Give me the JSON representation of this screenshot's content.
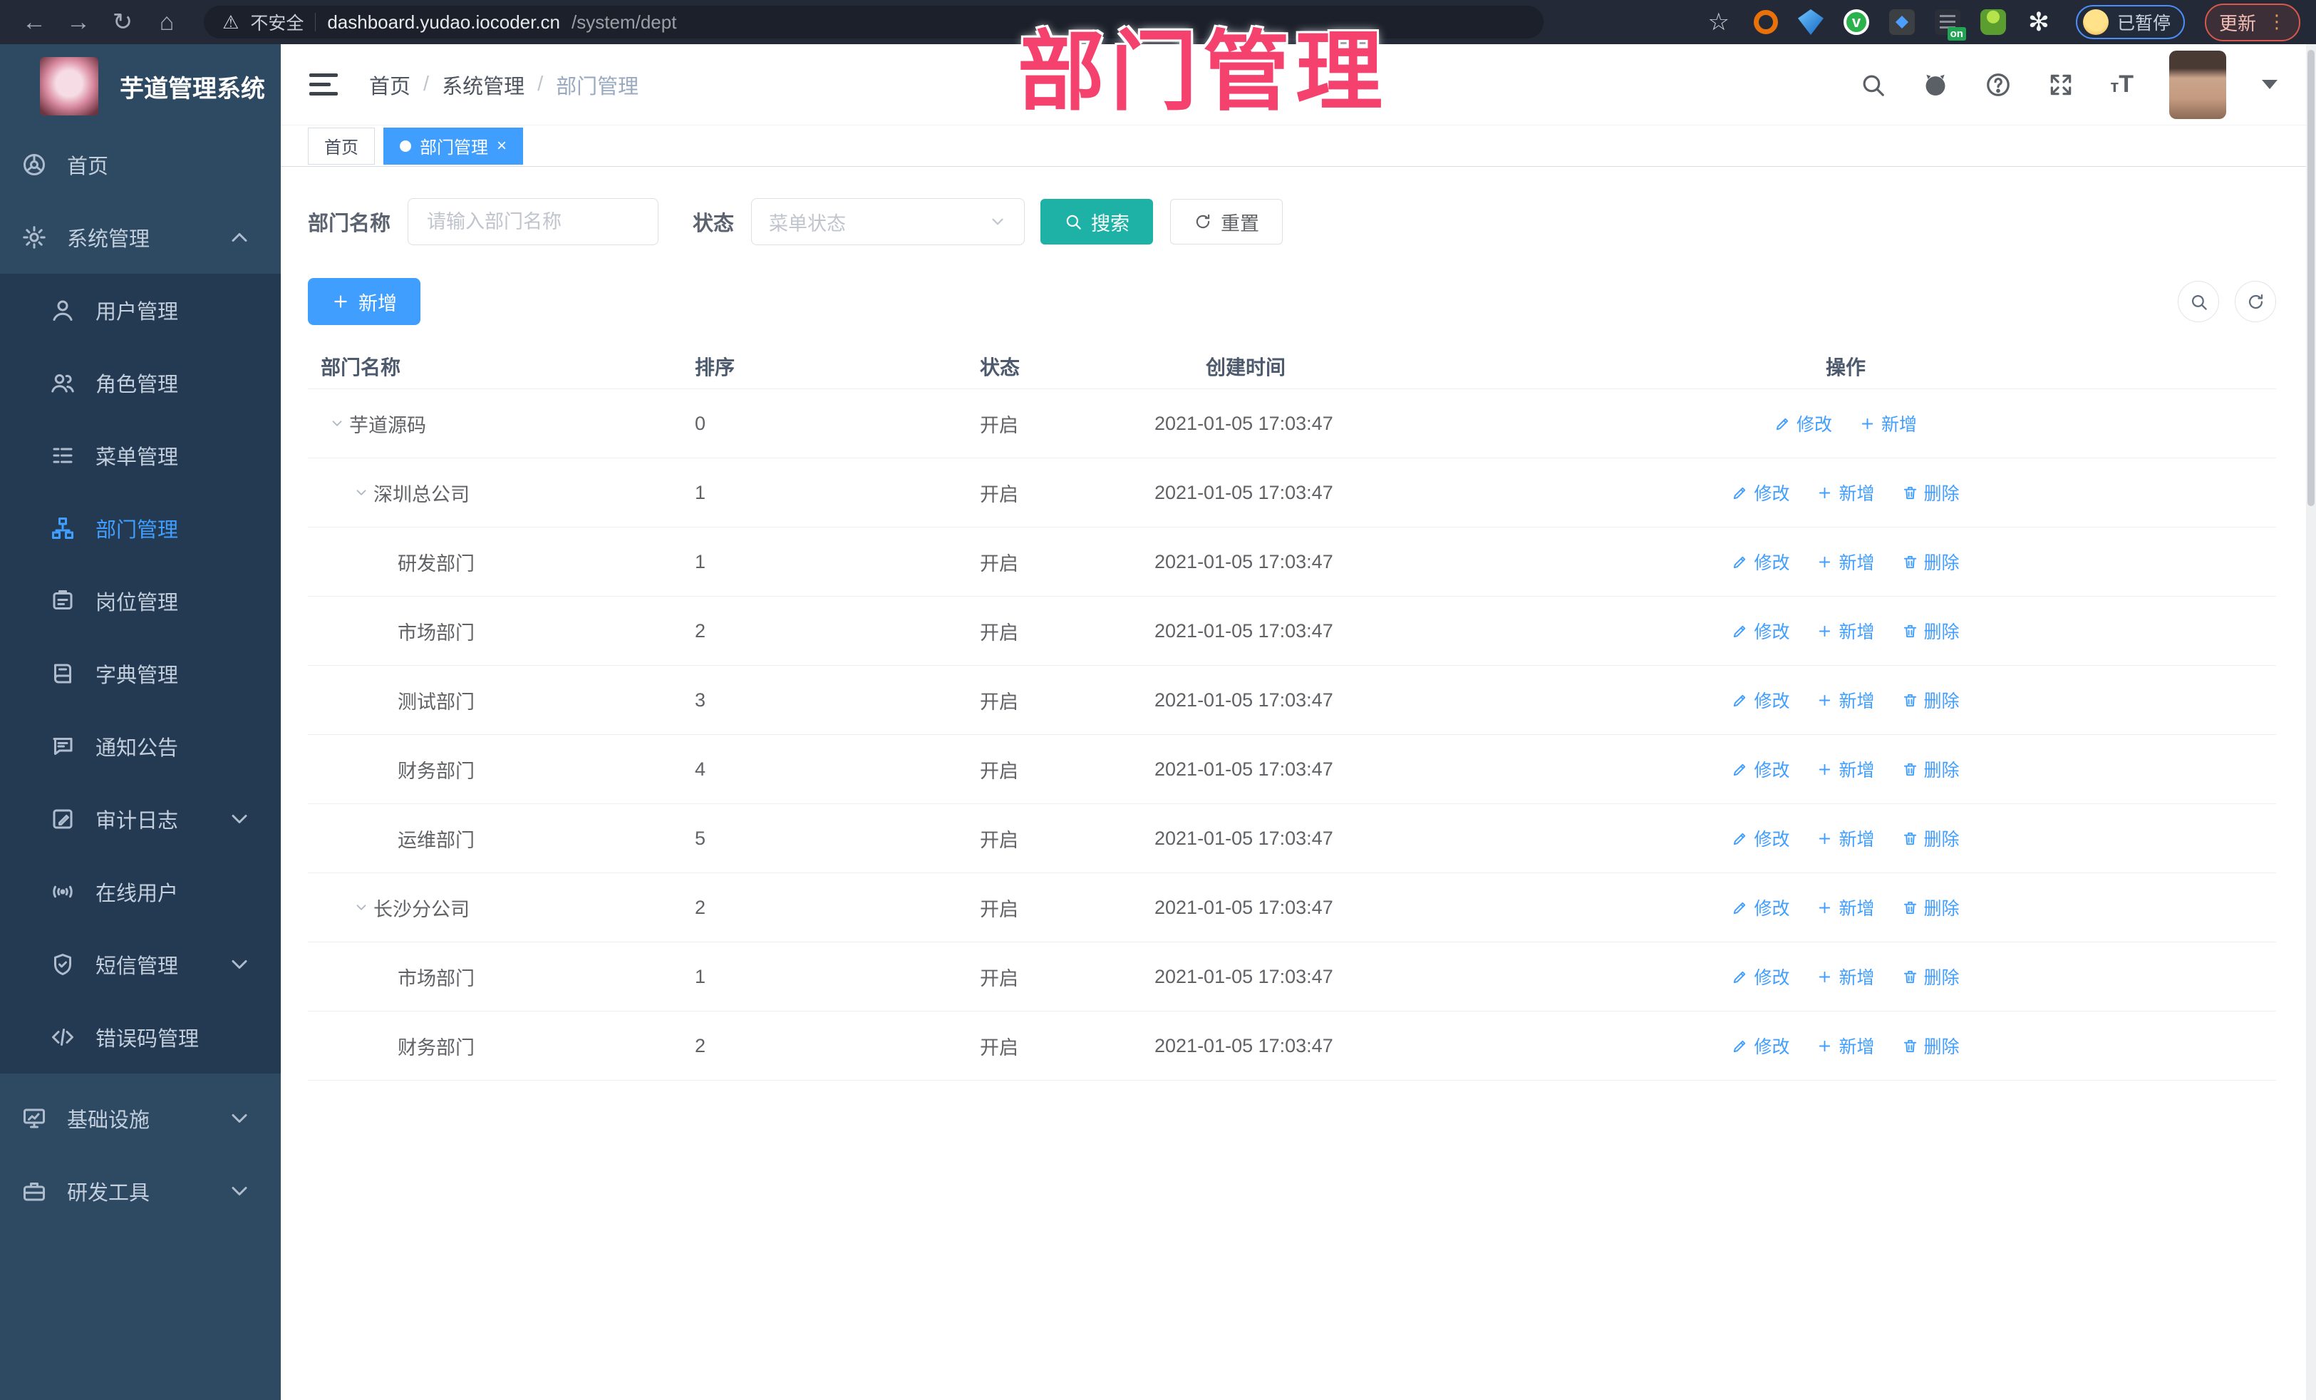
{
  "overlay": {
    "title": "部门管理"
  },
  "browser": {
    "security_label": "不安全",
    "url_host": "dashboard.yudao.iocoder.cn",
    "url_path": "/system/dept",
    "profile_status": "已暂停",
    "update_label": "更新",
    "extensions": [
      {
        "id": "orange-ring"
      },
      {
        "id": "blue-gem"
      },
      {
        "id": "green-check",
        "glyph": "v"
      },
      {
        "id": "blue-puzzle"
      },
      {
        "id": "list-on",
        "badge": "on"
      },
      {
        "id": "green-person"
      },
      {
        "id": "white-pinwheel",
        "glyph": "✻"
      }
    ]
  },
  "sidebar": {
    "logo_title": "芋道管理系统",
    "items": [
      {
        "id": "home",
        "label": "首页",
        "icon": "dashboard",
        "type": "top"
      },
      {
        "id": "system",
        "label": "系统管理",
        "icon": "gear",
        "type": "top",
        "chevron": "up"
      },
      {
        "id": "user",
        "label": "用户管理",
        "icon": "user",
        "type": "sub"
      },
      {
        "id": "role",
        "label": "角色管理",
        "icon": "users",
        "type": "sub"
      },
      {
        "id": "menu",
        "label": "菜单管理",
        "icon": "menu",
        "type": "sub"
      },
      {
        "id": "dept",
        "label": "部门管理",
        "icon": "tree",
        "type": "sub",
        "active": true
      },
      {
        "id": "post",
        "label": "岗位管理",
        "icon": "badge",
        "type": "sub"
      },
      {
        "id": "dict",
        "label": "字典管理",
        "icon": "book",
        "type": "sub"
      },
      {
        "id": "notice",
        "label": "通知公告",
        "icon": "message",
        "type": "sub"
      },
      {
        "id": "audit-log",
        "label": "审计日志",
        "icon": "editlog",
        "type": "sub",
        "chevron": "down"
      },
      {
        "id": "online",
        "label": "在线用户",
        "icon": "online",
        "type": "sub"
      },
      {
        "id": "sms",
        "label": "短信管理",
        "icon": "shield",
        "type": "sub",
        "chevron": "down"
      },
      {
        "id": "errcode",
        "label": "错误码管理",
        "icon": "code",
        "type": "sub"
      },
      {
        "id": "infra",
        "label": "基础设施",
        "icon": "monitor",
        "type": "top",
        "chevron": "down",
        "section": true
      },
      {
        "id": "devtool",
        "label": "研发工具",
        "icon": "tool",
        "type": "top",
        "chevron": "down"
      }
    ]
  },
  "header": {
    "breadcrumb": [
      "首页",
      "系统管理",
      "部门管理"
    ]
  },
  "tabs": [
    {
      "label": "首页"
    },
    {
      "label": "部门管理",
      "active": true,
      "closable": true
    }
  ],
  "search": {
    "name_label": "部门名称",
    "name_placeholder": "请输入部门名称",
    "status_label": "状态",
    "status_placeholder": "菜单状态",
    "search_label": "搜索",
    "reset_label": "重置"
  },
  "toolbar": {
    "add_label": "新增"
  },
  "table": {
    "headers": [
      "部门名称",
      "排序",
      "状态",
      "创建时间",
      "操作"
    ],
    "rows": [
      {
        "level": 0,
        "expandable": true,
        "name": "芋道源码",
        "sort": "0",
        "status": "开启",
        "time": "2021-01-05 17:03:47",
        "actions": [
          {
            "label": "修改",
            "icon": "pencil"
          },
          {
            "label": "新增",
            "icon": "plus"
          }
        ]
      },
      {
        "level": 1,
        "expandable": true,
        "name": "深圳总公司",
        "sort": "1",
        "status": "开启",
        "time": "2021-01-05 17:03:47",
        "actions": [
          {
            "label": "修改",
            "icon": "pencil"
          },
          {
            "label": "新增",
            "icon": "plus"
          },
          {
            "label": "删除",
            "icon": "trash"
          }
        ]
      },
      {
        "level": 2,
        "expandable": false,
        "name": "研发部门",
        "sort": "1",
        "status": "开启",
        "time": "2021-01-05 17:03:47",
        "actions": [
          {
            "label": "修改",
            "icon": "pencil"
          },
          {
            "label": "新增",
            "icon": "plus"
          },
          {
            "label": "删除",
            "icon": "trash"
          }
        ]
      },
      {
        "level": 2,
        "expandable": false,
        "name": "市场部门",
        "sort": "2",
        "status": "开启",
        "time": "2021-01-05 17:03:47",
        "actions": [
          {
            "label": "修改",
            "icon": "pencil"
          },
          {
            "label": "新增",
            "icon": "plus"
          },
          {
            "label": "删除",
            "icon": "trash"
          }
        ]
      },
      {
        "level": 2,
        "expandable": false,
        "name": "测试部门",
        "sort": "3",
        "status": "开启",
        "time": "2021-01-05 17:03:47",
        "actions": [
          {
            "label": "修改",
            "icon": "pencil"
          },
          {
            "label": "新增",
            "icon": "plus"
          },
          {
            "label": "删除",
            "icon": "trash"
          }
        ]
      },
      {
        "level": 2,
        "expandable": false,
        "name": "财务部门",
        "sort": "4",
        "status": "开启",
        "time": "2021-01-05 17:03:47",
        "actions": [
          {
            "label": "修改",
            "icon": "pencil"
          },
          {
            "label": "新增",
            "icon": "plus"
          },
          {
            "label": "删除",
            "icon": "trash"
          }
        ]
      },
      {
        "level": 2,
        "expandable": false,
        "name": "运维部门",
        "sort": "5",
        "status": "开启",
        "time": "2021-01-05 17:03:47",
        "actions": [
          {
            "label": "修改",
            "icon": "pencil"
          },
          {
            "label": "新增",
            "icon": "plus"
          },
          {
            "label": "删除",
            "icon": "trash"
          }
        ]
      },
      {
        "level": 1,
        "expandable": true,
        "name": "长沙分公司",
        "sort": "2",
        "status": "开启",
        "time": "2021-01-05 17:03:47",
        "actions": [
          {
            "label": "修改",
            "icon": "pencil"
          },
          {
            "label": "新增",
            "icon": "plus"
          },
          {
            "label": "删除",
            "icon": "trash"
          }
        ]
      },
      {
        "level": 2,
        "expandable": false,
        "name": "市场部门",
        "sort": "1",
        "status": "开启",
        "time": "2021-01-05 17:03:47",
        "actions": [
          {
            "label": "修改",
            "icon": "pencil"
          },
          {
            "label": "新增",
            "icon": "plus"
          },
          {
            "label": "删除",
            "icon": "trash"
          }
        ]
      },
      {
        "level": 2,
        "expandable": false,
        "name": "财务部门",
        "sort": "2",
        "status": "开启",
        "time": "2021-01-05 17:03:47",
        "actions": [
          {
            "label": "修改",
            "icon": "pencil"
          },
          {
            "label": "新增",
            "icon": "plus"
          },
          {
            "label": "删除",
            "icon": "trash"
          }
        ]
      }
    ]
  }
}
